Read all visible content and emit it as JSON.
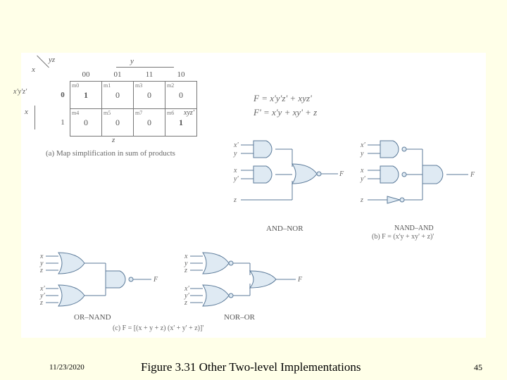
{
  "footer": {
    "date": "11/23/2020",
    "caption": "Figure 3.31 Other Two-level Implementations",
    "page": "45"
  },
  "kmap": {
    "corner_vars": "x",
    "col_var": "yz",
    "col_headers": [
      "00",
      "01",
      "11",
      "10"
    ],
    "row_headers": [
      "0",
      "1"
    ],
    "top_brace": "y",
    "right_brace": "xyz'",
    "left_brace": "x'y'z'",
    "side_brace": "x",
    "bottom_brace": "z",
    "cells": [
      [
        {
          "m": "m0",
          "v": "1"
        },
        {
          "m": "m1",
          "v": "0"
        },
        {
          "m": "m3",
          "v": "0"
        },
        {
          "m": "m2",
          "v": "0"
        }
      ],
      [
        {
          "m": "m4",
          "v": "0"
        },
        {
          "m": "m5",
          "v": "0"
        },
        {
          "m": "m7",
          "v": "0"
        },
        {
          "m": "m6",
          "v": "1"
        }
      ]
    ],
    "caption": "(a) Map simplification in sum of products"
  },
  "equations": {
    "F": "F = x'y'z' + xyz'",
    "Fp": "F' = x'y + xy' + z"
  },
  "circuits": {
    "and_nor": {
      "label": "AND–NOR",
      "inputs1": [
        "x'",
        "y"
      ],
      "inputs2": [
        "x",
        "y'"
      ],
      "input3": "z",
      "output": "F"
    },
    "nand_and": {
      "label": "NAND–AND",
      "caption": "(b) F = (x'y + xy' + z)'",
      "inputs1": [
        "x'",
        "y"
      ],
      "inputs2": [
        "x",
        "y'"
      ],
      "input3": "z",
      "output": "F"
    },
    "or_nand": {
      "label": "OR–NAND",
      "inputs1": [
        "x",
        "y",
        "z"
      ],
      "inputs2": [
        "x'",
        "y'",
        "z"
      ],
      "output": "F"
    },
    "nor_or": {
      "label": "NOR–OR",
      "inputs1": [
        "x",
        "y",
        "z"
      ],
      "inputs2": [
        "x'",
        "y'",
        "z"
      ],
      "output": "F"
    },
    "caption_c": "(c) F = [(x + y + z) (x' + y' + z)]'"
  }
}
